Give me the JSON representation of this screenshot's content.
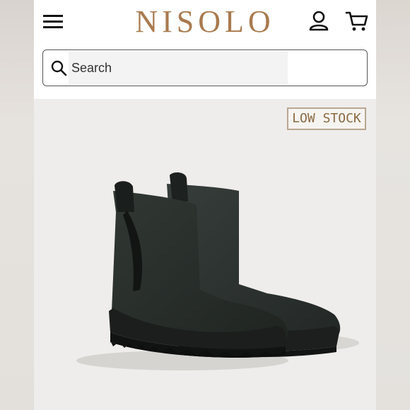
{
  "header": {
    "brand": "NISOLO",
    "icons": {
      "menu": "hamburger-menu-icon",
      "account": "account-icon",
      "cart": "cart-icon"
    }
  },
  "search": {
    "placeholder": "Search",
    "value": "",
    "icon": "search-icon"
  },
  "product": {
    "badge": "LOW STOCK",
    "image": "black-chelsea-boots"
  },
  "colors": {
    "brand": "#a97a4e",
    "badge_border": "#b9a690",
    "badge_text": "#8a6a42",
    "boot": "#2a302d"
  }
}
